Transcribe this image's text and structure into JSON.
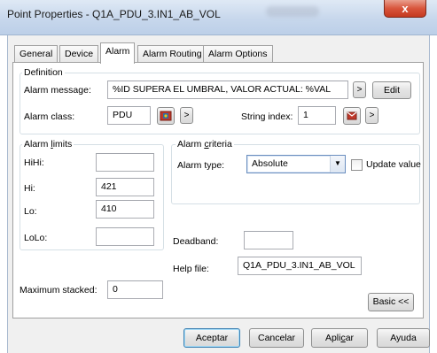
{
  "window": {
    "title": "Point Properties - Q1A_PDU_3.IN1_AB_VOL",
    "close_label": "x"
  },
  "tabs": [
    {
      "label": "General",
      "active": false
    },
    {
      "label": "Device",
      "active": false
    },
    {
      "label": "Alarm",
      "active": true
    },
    {
      "label": "Alarm Routing",
      "active": false
    },
    {
      "label": "Alarm Options",
      "active": false
    }
  ],
  "definition": {
    "legend": "Definition",
    "message_label": "Alarm message:",
    "message_value": "%ID SUPERA EL UMBRAL, VALOR ACTUAL: %VAL",
    "more_label": ">",
    "edit_label": "Edit",
    "class_label": "Alarm class:",
    "class_value": "PDU",
    "class_more_label": ">",
    "string_index_label": "String index:",
    "string_index_value": "1",
    "string_more_label": ">"
  },
  "limits": {
    "legend_pre": "Alarm ",
    "legend_accel": "l",
    "legend_post": "imits",
    "hihi_label": "HiHi:",
    "hihi_value": "",
    "hi_label": "Hi:",
    "hi_value": "421",
    "lo_label": "Lo:",
    "lo_value": "410",
    "lolo_label": "LoLo:",
    "lolo_value": ""
  },
  "criteria": {
    "legend_pre": "Alarm ",
    "legend_accel": "c",
    "legend_post": "riteria",
    "type_label": "Alarm type:",
    "type_value": "Absolute",
    "update_label": "Update value",
    "update_checked": false
  },
  "deadband": {
    "label": "Deadband:",
    "value": ""
  },
  "help_file": {
    "label": "Help file:",
    "value": "Q1A_PDU_3.IN1_AB_VOL"
  },
  "max_stacked": {
    "label": "Maximum stacked:",
    "value": "0"
  },
  "basic_label": "Basic <<",
  "footer": {
    "accept_label": "Aceptar",
    "cancel_label": "Cancelar",
    "apply_pre": "Apli",
    "apply_accel": "c",
    "apply_post": "ar",
    "help_label": "Ayuda"
  },
  "colors": {
    "class_icon": "#c0392b",
    "string_icon": "#c0392b",
    "accent": "#3c7fb1"
  }
}
